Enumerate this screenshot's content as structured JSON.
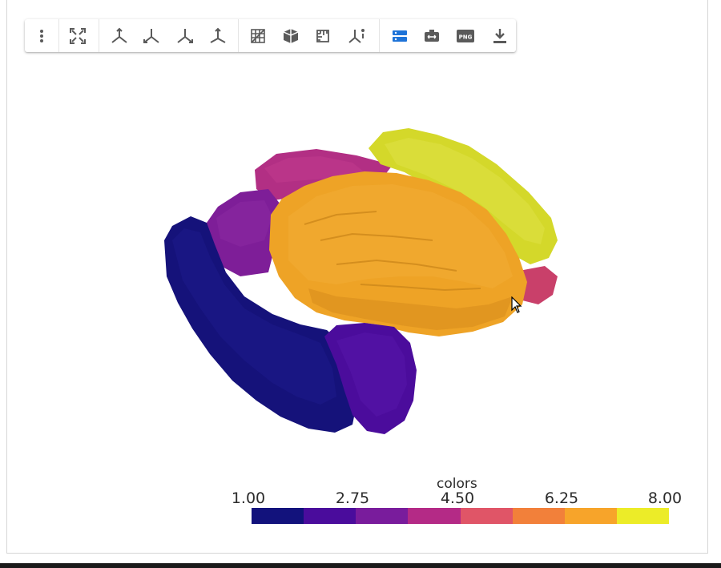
{
  "toolbar": {
    "buttons": [
      {
        "name": "menu-icon"
      },
      {
        "name": "fullscreen-icon"
      },
      {
        "name": "axis-view-isometric-icon"
      },
      {
        "name": "axis-view-left-icon"
      },
      {
        "name": "axis-view-right-icon"
      },
      {
        "name": "axis-view-up-icon"
      },
      {
        "name": "grid-icon"
      },
      {
        "name": "cube-box-icon"
      },
      {
        "name": "ruler-icon"
      },
      {
        "name": "axis-info-icon"
      },
      {
        "name": "server-controls-icon"
      },
      {
        "name": "camera-icon"
      },
      {
        "name": "png-screenshot-icon",
        "label": "PNG"
      },
      {
        "name": "download-icon"
      }
    ],
    "active_color": "#1e73d8",
    "icon_color": "#5a5a5a"
  },
  "colorbar": {
    "title": "colors",
    "ticks": [
      "1.00",
      "2.75",
      "4.50",
      "6.25",
      "8.00"
    ],
    "range": [
      1.0,
      8.0
    ],
    "segments": [
      "#0d0887",
      "#41049d",
      "#6a00a8",
      "#b12a90",
      "#e16462",
      "#f98e09",
      "#fca636",
      "#f0f921"
    ],
    "segment_colors_rendered": [
      "#12127c",
      "#4a0c9c",
      "#791c9c",
      "#b42a86",
      "#e05567",
      "#f2803a",
      "#f7a42a",
      "#ecec28"
    ]
  },
  "scene": {
    "regions": [
      {
        "name": "region-1",
        "value": 1,
        "color": "#15127a"
      },
      {
        "name": "region-2",
        "value": 2,
        "color": "#4b0c9c"
      },
      {
        "name": "region-3",
        "value": 3,
        "color": "#7e1e98"
      },
      {
        "name": "region-4",
        "value": 4,
        "color": "#b22f84"
      },
      {
        "name": "region-5",
        "value": 5,
        "color": "#c9406a"
      },
      {
        "name": "region-7",
        "value": 7,
        "color": "#eea326"
      },
      {
        "name": "region-8",
        "value": 8,
        "color": "#d4d82a"
      }
    ]
  }
}
